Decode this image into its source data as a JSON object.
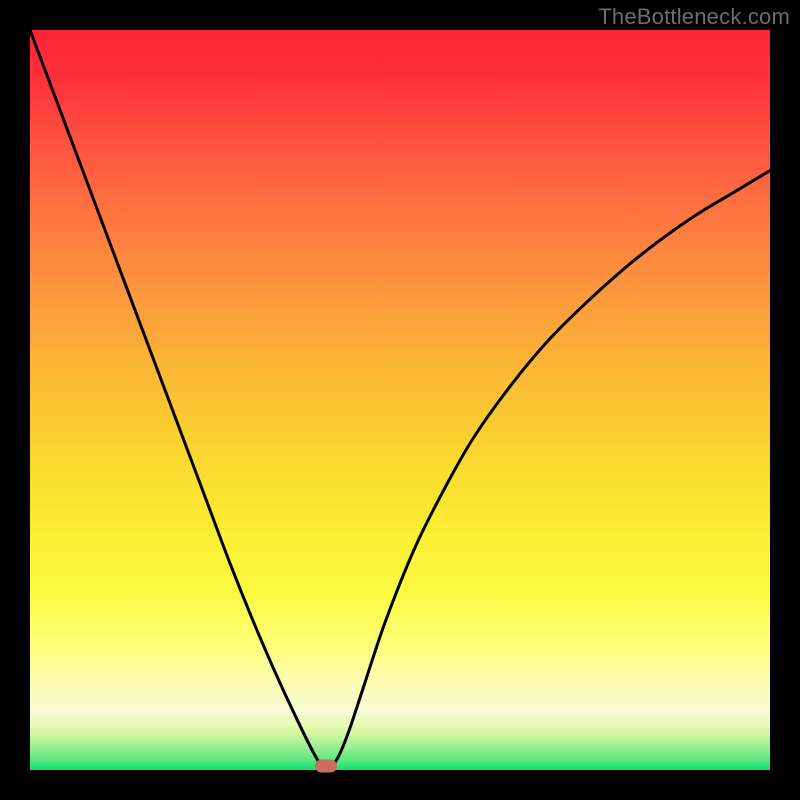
{
  "watermark": "TheBottleneck.com",
  "colors": {
    "frame": "#000000",
    "curve": "#000000",
    "marker": "#cd6d60"
  },
  "chart_data": {
    "type": "line",
    "title": "",
    "xlabel": "",
    "ylabel": "",
    "xlim": [
      0,
      1
    ],
    "ylim": [
      0,
      1
    ],
    "x": [
      0.0,
      0.03,
      0.06,
      0.09,
      0.12,
      0.15,
      0.18,
      0.21,
      0.24,
      0.27,
      0.3,
      0.33,
      0.36,
      0.385,
      0.4,
      0.415,
      0.43,
      0.45,
      0.48,
      0.52,
      0.56,
      0.6,
      0.65,
      0.7,
      0.75,
      0.8,
      0.85,
      0.9,
      0.95,
      1.0
    ],
    "values": [
      1.0,
      0.92,
      0.84,
      0.76,
      0.68,
      0.6,
      0.52,
      0.44,
      0.36,
      0.28,
      0.205,
      0.135,
      0.07,
      0.02,
      0.0,
      0.015,
      0.05,
      0.11,
      0.2,
      0.3,
      0.38,
      0.45,
      0.52,
      0.58,
      0.63,
      0.675,
      0.715,
      0.75,
      0.78,
      0.81
    ],
    "marker": {
      "x": 0.4,
      "y": 0.005
    },
    "gradient_background": true
  }
}
